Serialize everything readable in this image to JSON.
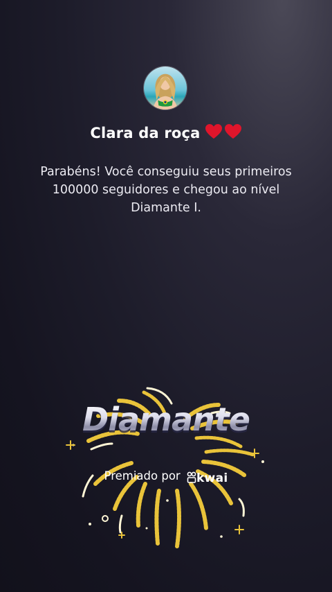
{
  "profile": {
    "name": "Clara da roça",
    "hearts": [
      "heart-icon",
      "heart-icon"
    ]
  },
  "message": {
    "text": "Parabéns! Você conseguiu seus primeiros 100000 seguidores e chegou ao nível Diamante I."
  },
  "badge": {
    "level_name": "Diamante",
    "awarded_by": "Premiado por",
    "brand": "Kwai"
  },
  "colors": {
    "background": "#1d1c2a",
    "heart": "#e0152b",
    "firework_gold": "#e9c33a",
    "firework_white": "#fff6d6"
  }
}
